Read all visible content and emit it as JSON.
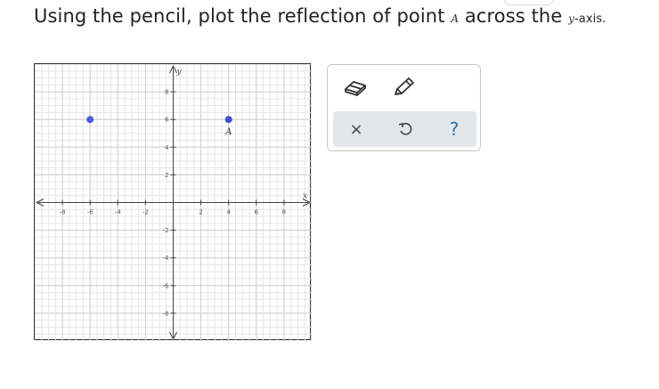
{
  "prompt": {
    "part1": "Using the pencil, plot the reflection of point ",
    "point_name": "A",
    "part2": " across the ",
    "axis_var": "y",
    "part3": "-axis."
  },
  "graph": {
    "x_axis_label": "x",
    "y_axis_label": "y",
    "xlim": [
      -10,
      10
    ],
    "ylim": [
      -10,
      10
    ],
    "x_ticks": [
      "-8",
      "-6",
      "-4",
      "-2",
      "2",
      "4",
      "6",
      "8"
    ],
    "y_ticks": [
      "8",
      "6",
      "4",
      "2",
      "-2",
      "-4",
      "-6",
      "-8"
    ],
    "points": [
      {
        "name": "",
        "x": -6,
        "y": 6,
        "color": "#4a5ae8"
      },
      {
        "name": "A",
        "x": 4,
        "y": 6,
        "color": "#3b4fd9"
      }
    ]
  },
  "toolbox": {
    "tools": [
      "eraser-icon",
      "pencil-icon"
    ],
    "actions": {
      "close": "×",
      "undo": "undo-icon",
      "help": "?"
    }
  }
}
